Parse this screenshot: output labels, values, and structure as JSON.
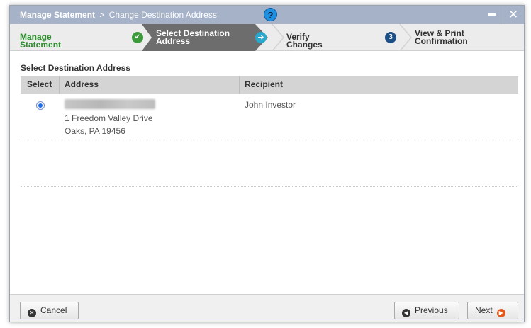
{
  "window": {
    "title_main": "Manage Statement",
    "title_separator": ">",
    "title_sub": "Change Destination Address",
    "help_label": "?",
    "close_label": "✕"
  },
  "steps": [
    {
      "label_line1": "Manage Statement",
      "label_line2": "",
      "state": "complete",
      "badge": "✔"
    },
    {
      "label_line1": "Select Destination",
      "label_line2": "Address",
      "state": "active",
      "badge": "➜"
    },
    {
      "label_line1": "Verify Changes",
      "label_line2": "",
      "state": "upcoming",
      "badge": "3"
    },
    {
      "label_line1": "View & Print",
      "label_line2": "Confirmation",
      "state": "upcoming",
      "badge": ""
    }
  ],
  "section": {
    "title": "Select Destination Address"
  },
  "table": {
    "columns": [
      "Select",
      "Address",
      "Recipient"
    ],
    "rows": [
      {
        "selected": true,
        "address_line1": "1 Freedom Valley Drive",
        "address_line2": "Oaks, PA 19456",
        "recipient": "John Investor"
      }
    ]
  },
  "footer": {
    "cancel_label": "Cancel",
    "previous_label": "Previous",
    "next_label": "Next"
  },
  "colors": {
    "titlebar": "#a6b2c8",
    "active_step": "#6d6d6d",
    "complete_green": "#2e8b2e",
    "next_icon": "#e4571b"
  }
}
